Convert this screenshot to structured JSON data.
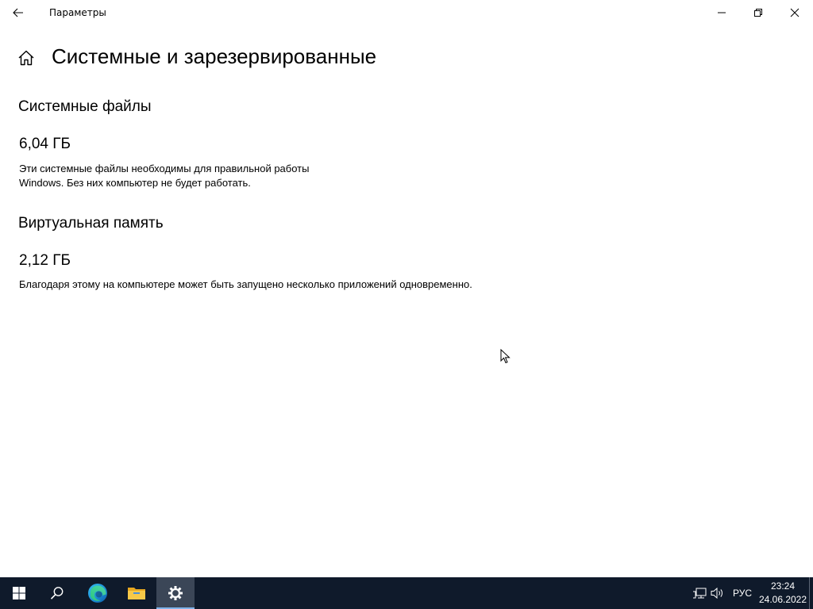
{
  "window": {
    "title": "Параметры"
  },
  "page": {
    "title": "Системные и зарезервированные"
  },
  "sections": [
    {
      "title": "Системные файлы",
      "size": "6,04 ГБ",
      "description_lines": [
        "Эти системные файлы необходимы для правильной работы",
        "Windows. Без них компьютер не будет работать."
      ]
    },
    {
      "title": "Виртуальная память",
      "size": "2,12 ГБ",
      "description_lines": [
        "Благодаря этому на компьютере может быть запущено несколько приложений одновременно."
      ]
    }
  ],
  "taskbar": {
    "items": [
      "start-icon",
      "search-icon",
      "edge-icon",
      "file-explorer-icon",
      "settings-icon"
    ],
    "active_item": "settings-icon",
    "language": "РУС",
    "time": "23:24",
    "date": "24.06.2022"
  },
  "colors": {
    "taskbar_bg": "#0f1a2b",
    "taskbar_active": "#3b4657",
    "active_indicator": "#7fb3ea"
  }
}
